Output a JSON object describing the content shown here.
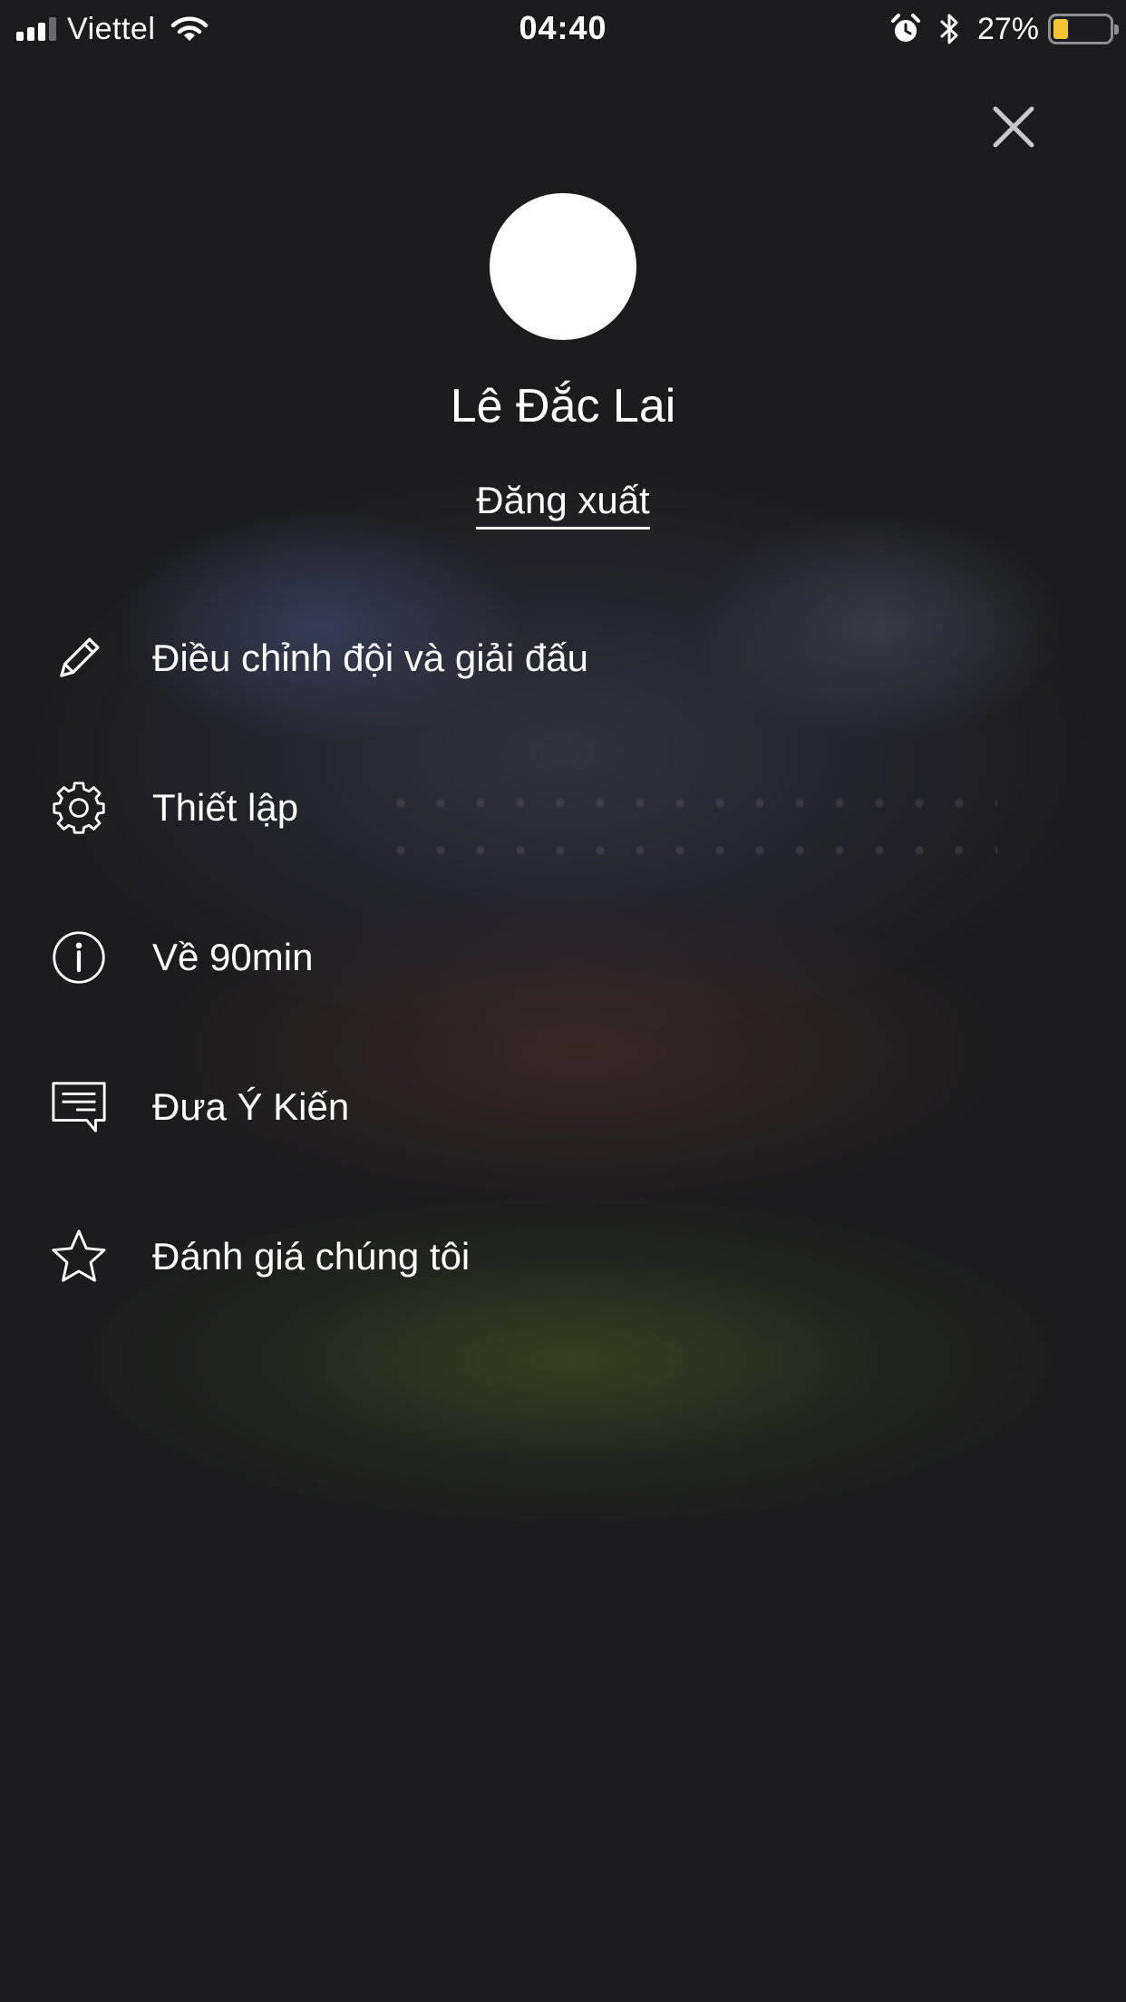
{
  "status_bar": {
    "carrier": "Viettel",
    "time": "04:40",
    "battery_percent": "27%",
    "battery_level": 0.27,
    "battery_color": "#f4c430",
    "icons": [
      "signal-icon",
      "wifi-icon",
      "alarm-icon",
      "bluetooth-icon",
      "battery-icon"
    ]
  },
  "header": {
    "close_icon": "close-icon"
  },
  "profile": {
    "name": "Lê Đắc Lai",
    "logout_label": "Đăng xuất"
  },
  "menu": {
    "items": [
      {
        "label": "Điều chỉnh đội và giải đấu",
        "icon": "pencil-icon"
      },
      {
        "label": "Thiết lập",
        "icon": "gear-icon"
      },
      {
        "label": "Về 90min",
        "icon": "info-icon"
      },
      {
        "label": "Đưa Ý Kiến",
        "icon": "feedback-icon"
      },
      {
        "label": "Đánh giá chúng tôi",
        "icon": "star-icon"
      }
    ]
  },
  "colors": {
    "background": "#1c1c1e",
    "text": "#ffffff"
  }
}
